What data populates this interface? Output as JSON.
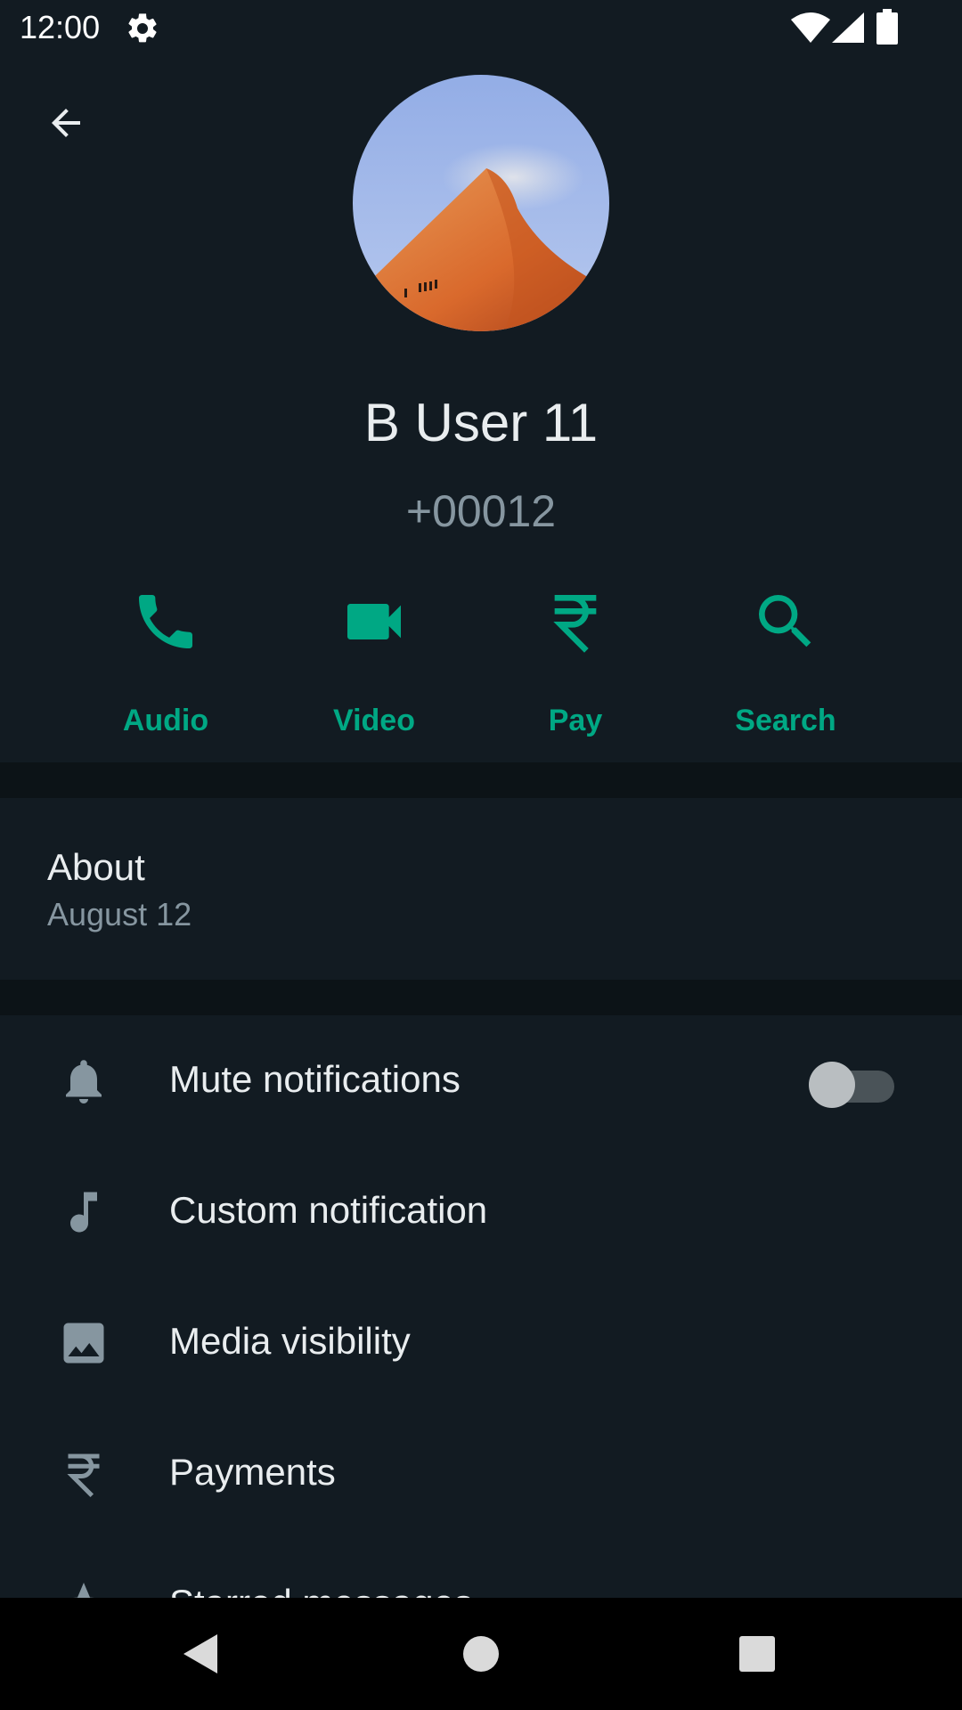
{
  "status_bar": {
    "time": "12:00"
  },
  "contact": {
    "name": "B User 11",
    "phone": "+00012"
  },
  "actions": [
    {
      "label": "Audio",
      "icon": "phone-icon"
    },
    {
      "label": "Video",
      "icon": "videocam-icon"
    },
    {
      "label": "Pay",
      "icon": "rupee-icon"
    },
    {
      "label": "Search",
      "icon": "search-icon"
    }
  ],
  "about": {
    "title": "About",
    "value": "August 12"
  },
  "settings": [
    {
      "label": "Mute notifications",
      "icon": "bell-icon",
      "toggle_on": false
    },
    {
      "label": "Custom notification",
      "icon": "music-note-icon"
    },
    {
      "label": "Media visibility",
      "icon": "image-icon"
    },
    {
      "label": "Payments",
      "icon": "rupee-icon"
    },
    {
      "label": "Starred messages",
      "icon": "star-icon"
    }
  ],
  "colors": {
    "background": "#121b22",
    "accent": "#00a884",
    "secondary_text": "#8696a0",
    "divider": "#0c1317"
  }
}
